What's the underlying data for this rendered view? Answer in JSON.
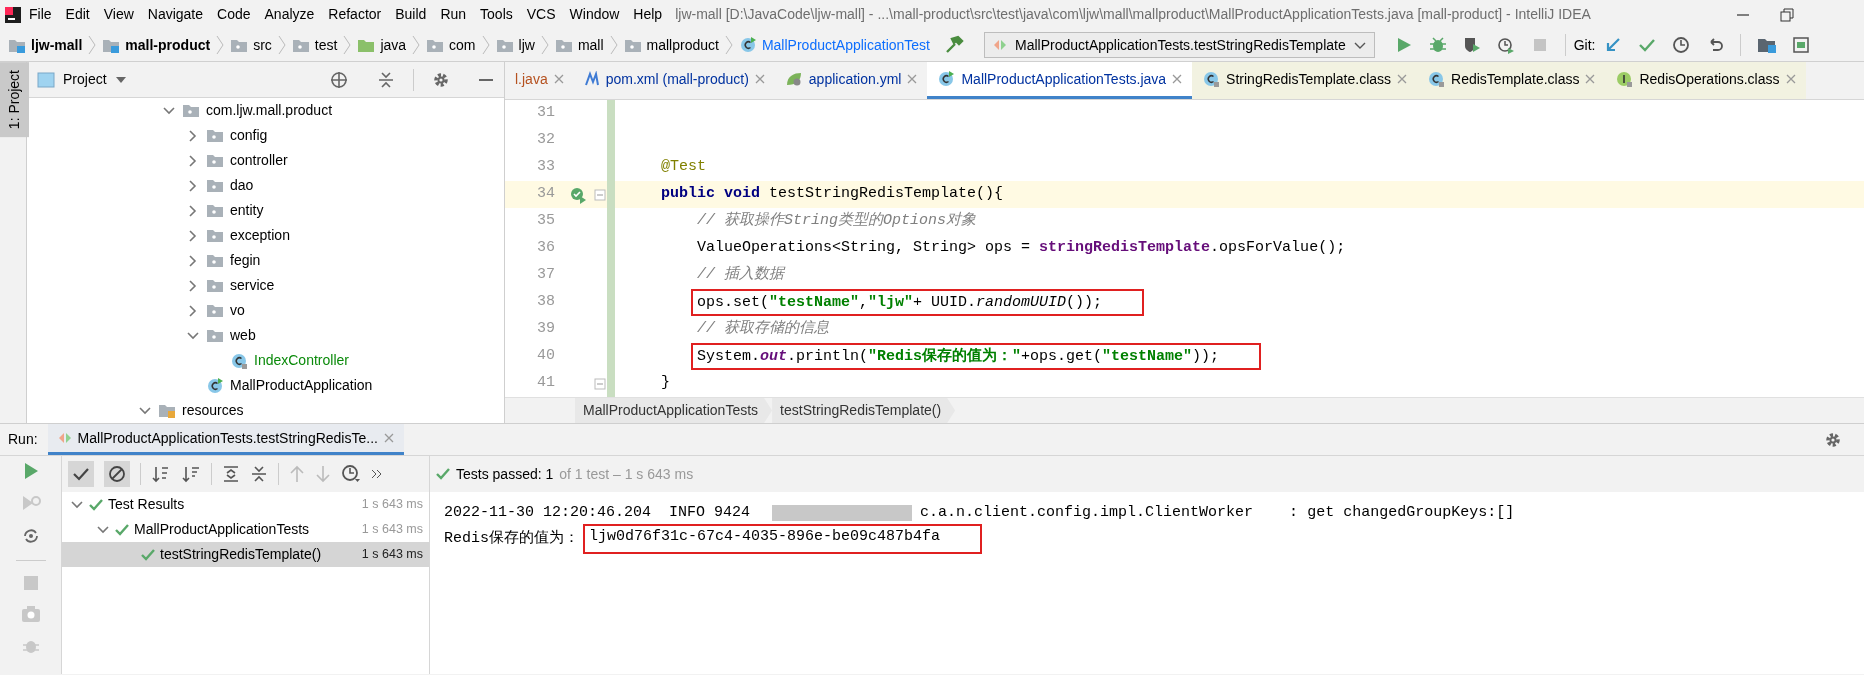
{
  "menu": [
    "File",
    "Edit",
    "View",
    "Navigate",
    "Code",
    "Analyze",
    "Refactor",
    "Build",
    "Run",
    "Tools",
    "VCS",
    "Window",
    "Help"
  ],
  "window": {
    "title": "ljw-mall [D:\\JavaCode\\ljw-mall] - ...\\mall-product\\src\\test\\java\\com\\ljw\\mall\\mallproduct\\MallProductApplicationTests.java [mall-product] - IntelliJ IDEA"
  },
  "navbar": {
    "crumbs": [
      {
        "label": "ljw-mall",
        "kind": "module"
      },
      {
        "label": "mall-product",
        "kind": "module"
      },
      {
        "label": "src",
        "kind": "folder"
      },
      {
        "label": "test",
        "kind": "folder"
      },
      {
        "label": "java",
        "kind": "source"
      },
      {
        "label": "com",
        "kind": "package"
      },
      {
        "label": "ljw",
        "kind": "package"
      },
      {
        "label": "mall",
        "kind": "package"
      },
      {
        "label": "mallproduct",
        "kind": "package"
      },
      {
        "label": "MallProductApplicationTest",
        "kind": "class"
      }
    ],
    "run_config": "MallProductApplicationTests.testStringRedisTemplate",
    "git_label": "Git:"
  },
  "stripe": {
    "label": "1: Project",
    "selected": true
  },
  "project": {
    "title": "Project",
    "tree": [
      {
        "label": "com.ljw.mall.product",
        "kind": "package",
        "expanded": true,
        "children": [
          {
            "label": "config",
            "kind": "package",
            "expanded": false
          },
          {
            "label": "controller",
            "kind": "package",
            "expanded": false
          },
          {
            "label": "dao",
            "kind": "package",
            "expanded": false
          },
          {
            "label": "entity",
            "kind": "package",
            "expanded": false
          },
          {
            "label": "exception",
            "kind": "package",
            "expanded": false
          },
          {
            "label": "fegin",
            "kind": "package",
            "expanded": false
          },
          {
            "label": "service",
            "kind": "package",
            "expanded": false
          },
          {
            "label": "vo",
            "kind": "package",
            "expanded": false
          },
          {
            "label": "web",
            "kind": "package",
            "expanded": true,
            "children": [
              {
                "label": "IndexController",
                "kind": "class",
                "color": "#0a8a0a"
              }
            ]
          },
          {
            "label": "MallProductApplication",
            "kind": "app",
            "color": "#000000"
          }
        ]
      },
      {
        "label": "resources",
        "kind": "resource-root",
        "expanded": true
      }
    ]
  },
  "editor": {
    "tabs": [
      {
        "label": "l.java",
        "kind": "file",
        "color": "#b5511f",
        "library": false,
        "selected": false
      },
      {
        "label": "pom.xml (mall-product)",
        "kind": "maven",
        "color": "#0032a0",
        "library": false,
        "selected": false
      },
      {
        "label": "application.yml",
        "kind": "yaml",
        "color": "#0032a0",
        "library": false,
        "selected": false
      },
      {
        "label": "MallProductApplicationTests.java",
        "kind": "test-class",
        "color": "#0032a0",
        "library": false,
        "selected": true
      },
      {
        "label": "StringRedisTemplate.class",
        "kind": "class",
        "color": "#000000",
        "library": true,
        "selected": false
      },
      {
        "label": "RedisTemplate.class",
        "kind": "class",
        "color": "#000000",
        "library": true,
        "selected": false
      },
      {
        "label": "RedisOperations.class",
        "kind": "interface",
        "color": "#000000",
        "library": true,
        "selected": false
      }
    ],
    "lines": [
      {
        "number": "31",
        "current": false,
        "run_marker": false,
        "fold": false
      },
      {
        "number": "32",
        "current": false,
        "run_marker": false,
        "fold": false
      },
      {
        "number": "33",
        "current": false,
        "highlighted": false,
        "run_marker": false,
        "fold": false,
        "tokens": [
          {
            "text": "    @Test",
            "kind": "annotation"
          }
        ]
      },
      {
        "number": "34",
        "current": true,
        "highlighted": false,
        "run_marker": true,
        "fold": true,
        "tokens": [
          {
            "text": "    public void",
            "kind": "keyword"
          },
          {
            "text": " testStringRedisTemplate(){",
            "kind": "plain"
          }
        ]
      },
      {
        "number": "35",
        "current": false,
        "highlighted": false,
        "run_marker": false,
        "fold": false,
        "tokens": [
          {
            "text": "        // 获取操作String类型的Options对象",
            "kind": "comment"
          }
        ]
      },
      {
        "number": "36",
        "current": false,
        "highlighted": false,
        "run_marker": false,
        "fold": false,
        "tokens": [
          {
            "text": "        ValueOperations<String, String> ops = ",
            "kind": "plain"
          },
          {
            "text": "stringRedisTemplate",
            "kind": "field"
          },
          {
            "text": ".opsForValue();",
            "kind": "plain"
          }
        ]
      },
      {
        "number": "37",
        "current": false,
        "highlighted": false,
        "run_marker": false,
        "fold": false,
        "tokens": [
          {
            "text": "        // 插入数据",
            "kind": "comment"
          }
        ]
      },
      {
        "number": "38",
        "current": false,
        "highlighted": true,
        "run_marker": false,
        "fold": false,
        "tokens": [
          {
            "text": "        ops.set(",
            "kind": "plain"
          },
          {
            "text": "\"testName\"",
            "kind": "string"
          },
          {
            "text": ",",
            "kind": "plain"
          },
          {
            "text": "\"ljw\"",
            "kind": "string"
          },
          {
            "text": "+ UUID.",
            "kind": "plain"
          },
          {
            "text": "randomUUID",
            "kind": "static"
          },
          {
            "text": "());",
            "kind": "plain"
          }
        ]
      },
      {
        "number": "39",
        "current": false,
        "highlighted": false,
        "run_marker": false,
        "fold": false,
        "tokens": [
          {
            "text": "        // 获取存储的信息",
            "kind": "comment"
          }
        ]
      },
      {
        "number": "40",
        "current": false,
        "highlighted": true,
        "run_marker": false,
        "fold": false,
        "tokens": [
          {
            "text": "        System.",
            "kind": "plain"
          },
          {
            "text": "out",
            "kind": "static-field"
          },
          {
            "text": ".println(",
            "kind": "plain"
          },
          {
            "text": "\"Redis保存的值为：\"",
            "kind": "string"
          },
          {
            "text": "+ops.get(",
            "kind": "plain"
          },
          {
            "text": "\"testName\"",
            "kind": "string"
          },
          {
            "text": "));",
            "kind": "plain"
          }
        ]
      },
      {
        "number": "41",
        "current": false,
        "highlighted": false,
        "run_marker": false,
        "fold": true,
        "tokens": [
          {
            "text": "    }",
            "kind": "plain"
          }
        ]
      }
    ],
    "breadcrumbs": [
      "MallProductApplicationTests",
      "testStringRedisTemplate()"
    ]
  },
  "run": {
    "label": "Run:",
    "tab": {
      "label": "MallProductApplicationTests.testStringRedisTe...",
      "selected": true
    },
    "filters": [
      {
        "kind": "passed",
        "selected": true
      },
      {
        "kind": "ignored",
        "selected": true
      }
    ],
    "status_label": "Tests passed: 1",
    "status_detail": "of 1 test – 1 s 643 ms",
    "tests": [
      {
        "label": "Test Results",
        "time": "1 s 643 ms",
        "passed": true,
        "expanded": true,
        "selected": false,
        "children": [
          {
            "label": "MallProductApplicationTests",
            "time": "1 s 643 ms",
            "passed": true,
            "expanded": true,
            "selected": false,
            "children": [
              {
                "label": "testStringRedisTemplate()",
                "time": "1 s 643 ms",
                "passed": true,
                "selected": true
              }
            ]
          }
        ]
      }
    ],
    "console": [
      {
        "segments": [
          {
            "text": "2022-11-30 12:20:46.204  INFO 9424",
            "kind": "plain",
            "highlighted": false
          },
          {
            "kind": "redacted"
          },
          {
            "text": "c.a.n.client.config.impl.ClientWorker    : get changedGroupKeys:[]",
            "kind": "plain",
            "highlighted": false
          }
        ]
      },
      {
        "segments": [
          {
            "text": "Redis保存的值为：",
            "kind": "plain",
            "highlighted": false
          },
          {
            "text": "ljw0d76f31c-67c4-4035-896e-be09c487b4fa",
            "kind": "plain",
            "highlighted": true
          }
        ]
      }
    ]
  }
}
